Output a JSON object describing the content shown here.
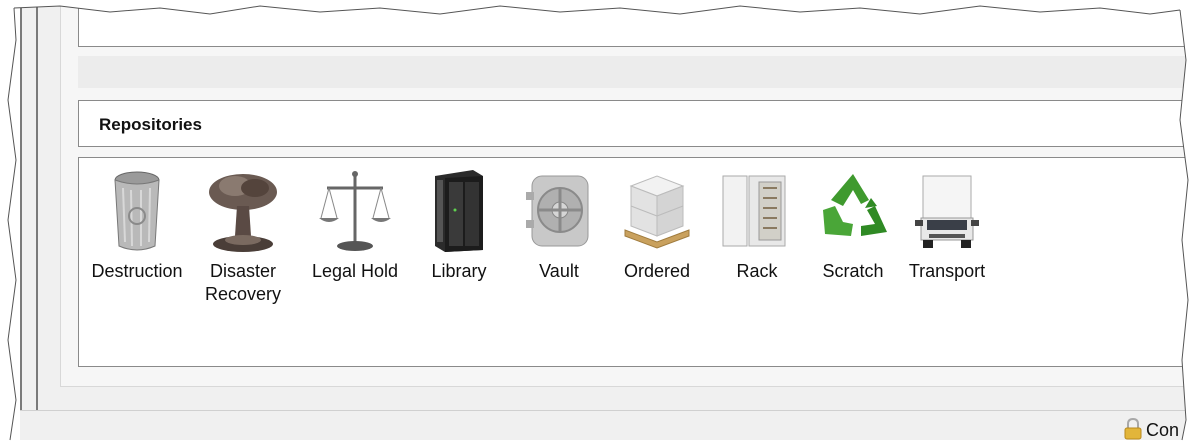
{
  "section": {
    "title": "Repositories"
  },
  "repositories": [
    {
      "label": "Destruction",
      "icon": "trash-can-icon"
    },
    {
      "label": "Disaster Recovery",
      "icon": "mushroom-cloud-icon"
    },
    {
      "label": "Legal Hold",
      "icon": "scales-icon"
    },
    {
      "label": "Library",
      "icon": "server-rack-icon"
    },
    {
      "label": "Vault",
      "icon": "vault-door-icon"
    },
    {
      "label": "Ordered",
      "icon": "boxes-on-pallet-icon"
    },
    {
      "label": "Rack",
      "icon": "cabinet-icon"
    },
    {
      "label": "Scratch",
      "icon": "recycle-icon"
    },
    {
      "label": "Transport",
      "icon": "truck-icon"
    }
  ],
  "status": {
    "text": "Con",
    "icon": "lock-icon"
  }
}
